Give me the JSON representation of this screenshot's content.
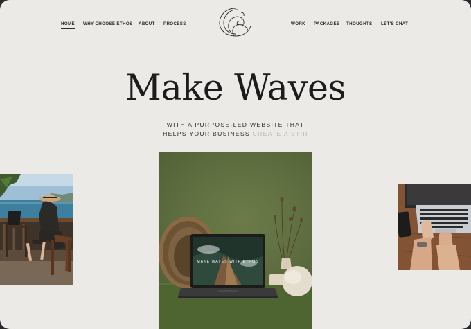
{
  "nav": {
    "left": [
      "HOME",
      "WHY CHOOSE ETHOS",
      "ABOUT",
      "PROCESS"
    ],
    "right": [
      "WORK",
      "PACKAGES",
      "THOUGHTS",
      "LET'S CHAT"
    ]
  },
  "hero": {
    "title": "Make Waves",
    "subtitle_line1": "WITH A PURPOSE-LED WEBSITE THAT",
    "subtitle_line2": "HELPS YOUR BUSINESS",
    "subtitle_accent": "CREATE A STIR"
  },
  "laptop_screen": {
    "text": "MAKE WAVES WITH ETHOS"
  },
  "colors": {
    "background": "#eceae6",
    "text": "#1c1c1c",
    "accent_soft": "#b9b5ae",
    "olive": "#5c6e3b"
  }
}
